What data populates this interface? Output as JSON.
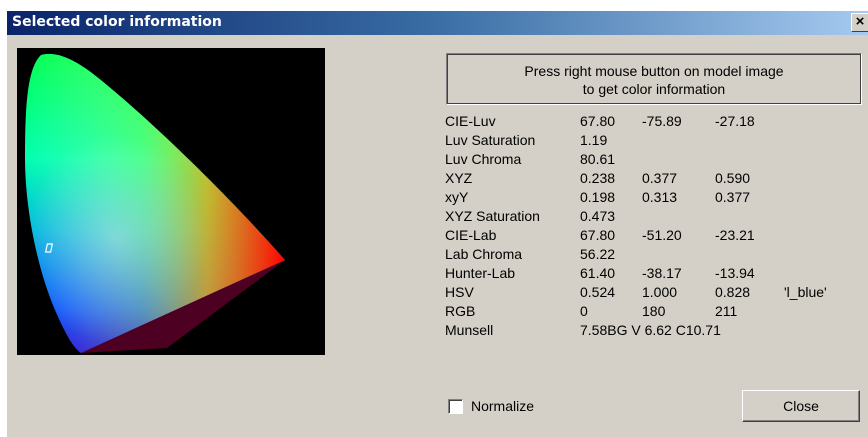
{
  "window": {
    "title": "Selected color information",
    "close_glyph": "×",
    "titlebar_color": "#0a246a"
  },
  "model_image": {
    "icon": "cie-chromaticity-diagram-icon",
    "marker": "selected-color-marker"
  },
  "info": {
    "line1": "Press right mouse button on model image",
    "line2": "to get color information"
  },
  "rows": [
    {
      "label": "CIE-Luv",
      "v1": "67.80",
      "v2": "-75.89",
      "v3": "-27.18",
      "v4": ""
    },
    {
      "label": "Luv Saturation",
      "v1": "1.19",
      "v2": "",
      "v3": "",
      "v4": ""
    },
    {
      "label": "Luv Chroma",
      "v1": "80.61",
      "v2": "",
      "v3": "",
      "v4": ""
    },
    {
      "label": "XYZ",
      "v1": "0.238",
      "v2": "0.377",
      "v3": "0.590",
      "v4": ""
    },
    {
      "label": "xyY",
      "v1": "0.198",
      "v2": "0.313",
      "v3": "0.377",
      "v4": ""
    },
    {
      "label": "XYZ Saturation",
      "v1": "0.473",
      "v2": "",
      "v3": "",
      "v4": ""
    },
    {
      "label": "CIE-Lab",
      "v1": "67.80",
      "v2": "-51.20",
      "v3": "-23.21",
      "v4": ""
    },
    {
      "label": "Lab Chroma",
      "v1": "56.22",
      "v2": "",
      "v3": "",
      "v4": ""
    },
    {
      "label": "Hunter-Lab",
      "v1": "61.40",
      "v2": "-38.17",
      "v3": "-13.94",
      "v4": ""
    },
    {
      "label": "HSV",
      "v1": "0.524",
      "v2": "1.000",
      "v3": "0.828",
      "v4": "'l_blue'"
    },
    {
      "label": "RGB",
      "v1": "0",
      "v2": "180",
      "v3": "211",
      "v4": ""
    },
    {
      "label": "Munsell",
      "v1": "7.58BG  V 6.62  C10.71",
      "v2": "",
      "v3": "",
      "v4": ""
    }
  ],
  "normalize": {
    "label": "Normalize",
    "checked": false
  },
  "close_button": {
    "label": "Close"
  }
}
